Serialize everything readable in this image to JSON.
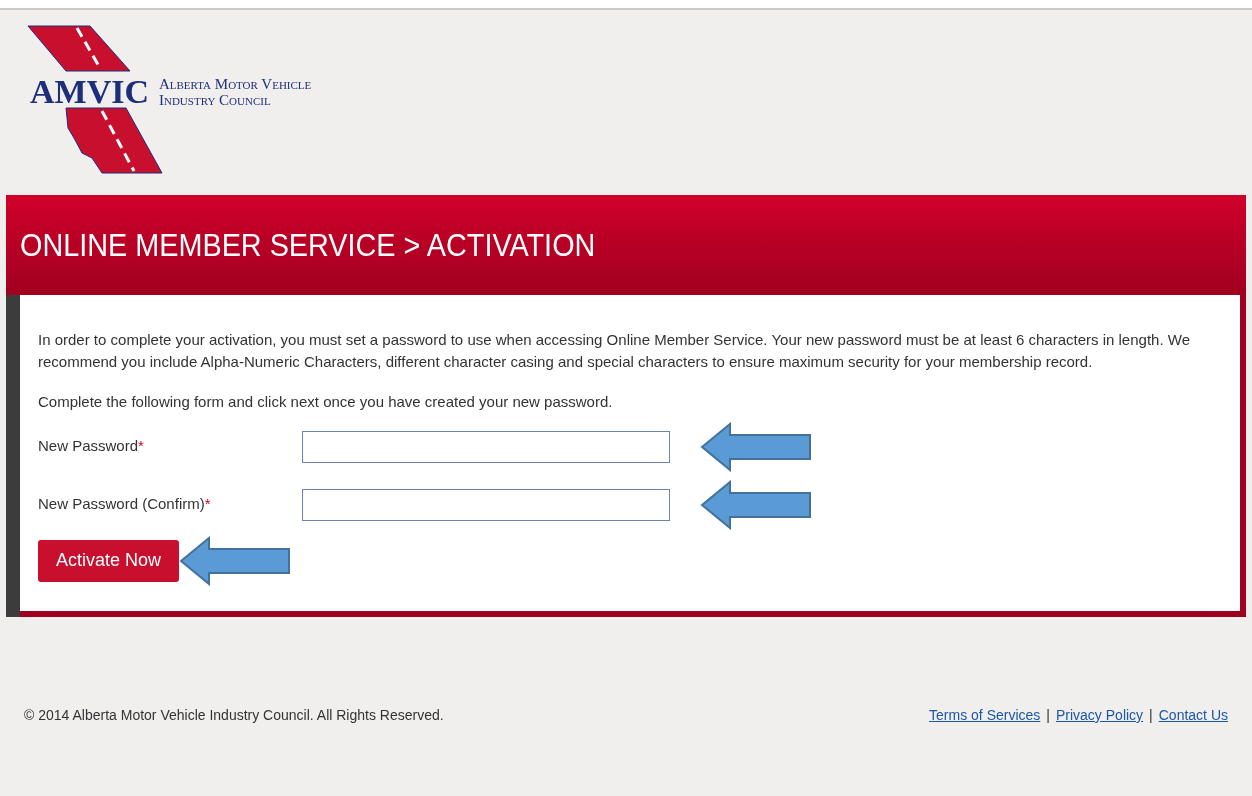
{
  "logo": {
    "acronym": "AMVIC",
    "name_lines": [
      "Alberta Motor Vehicle",
      "Industry Council"
    ]
  },
  "banner": {
    "title": "ONLINE MEMBER SERVICE > ACTIVATION"
  },
  "content": {
    "intro": "In order to complete your activation, you must set a password to use when accessing Online Member Service. Your new password must be at least 6 characters in length. We recommend you include Alpha-Numeric Characters, different character casing and special characters to ensure maximum security for your membership record.",
    "instruction": "Complete the following form and click next once you have created your new password.",
    "fields": [
      {
        "label": "New Password",
        "required_mark": "*"
      },
      {
        "label": "New Password (Confirm)",
        "required_mark": "*"
      }
    ],
    "submit": "Activate Now"
  },
  "footer": {
    "copyright": "© 2014 Alberta Motor Vehicle Industry Council. All Rights Reserved.",
    "links": [
      "Terms of Services",
      "Privacy Policy",
      "Contact Us"
    ],
    "separator": "|"
  }
}
